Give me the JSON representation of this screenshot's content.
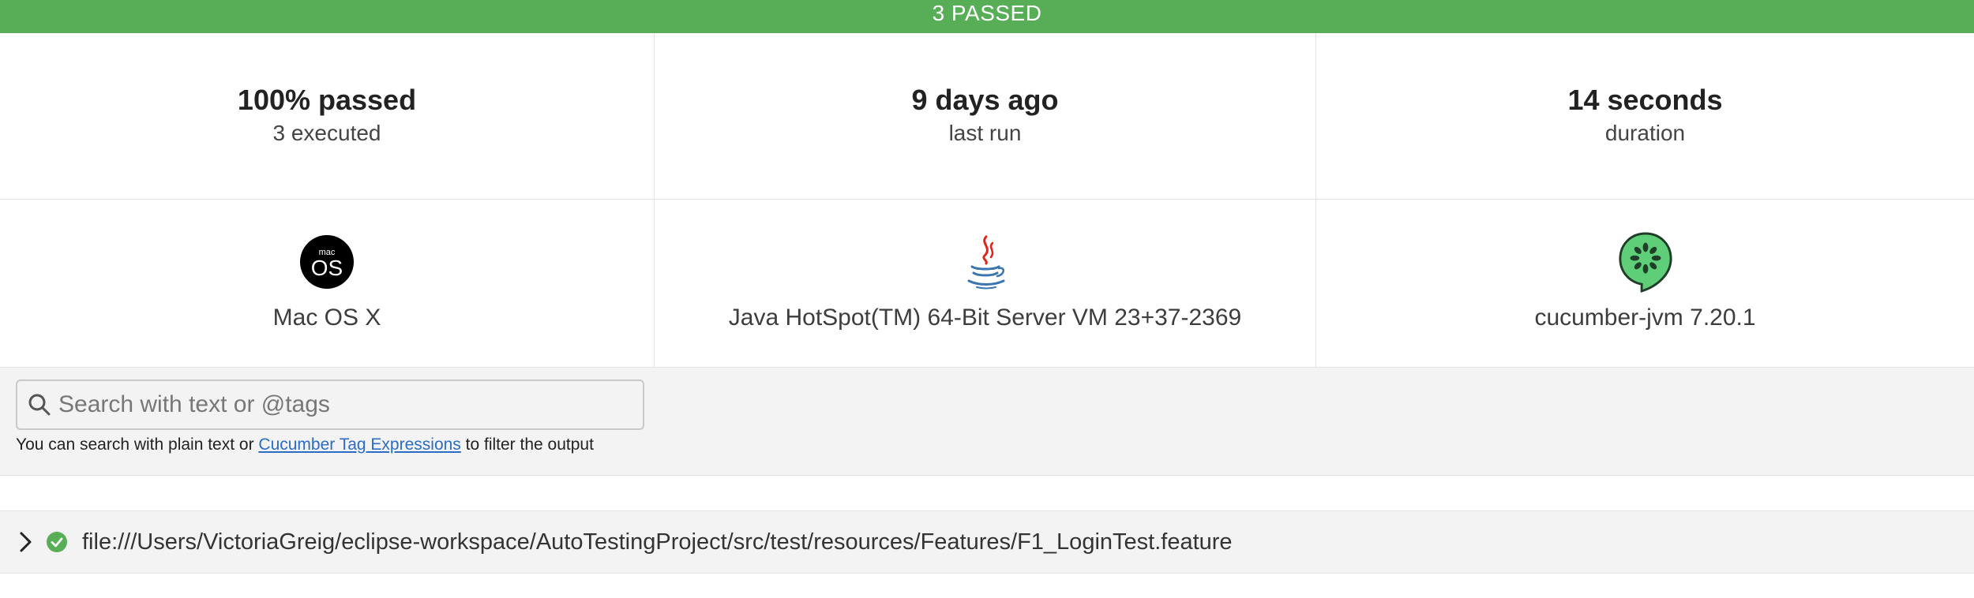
{
  "banner": {
    "status_text": "3 PASSED",
    "color": "#58ae57"
  },
  "summary": {
    "passed": {
      "value": "100% passed",
      "label": "3 executed"
    },
    "last_run": {
      "value": "9 days ago",
      "label": "last run"
    },
    "duration": {
      "value": "14 seconds",
      "label": "duration"
    }
  },
  "environment": {
    "os": {
      "icon": "macos-icon",
      "icon_text_top": "mac",
      "icon_text_main": "OS",
      "label": "Mac OS X"
    },
    "runtime": {
      "icon": "java-icon",
      "label": "Java HotSpot(TM) 64-Bit Server VM 23+37-2369"
    },
    "implementation": {
      "icon": "cucumber-icon",
      "label": "cucumber-jvm 7.20.1"
    }
  },
  "search": {
    "placeholder": "Search with text or @tags",
    "value": "",
    "help_prefix": "You can search with plain text or ",
    "help_link": "Cucumber Tag Expressions",
    "help_suffix": " to filter the output"
  },
  "features": [
    {
      "path": "file:///Users/VictoriaGreig/eclipse-workspace/AutoTestingProject/src/test/resources/Features/F1_LoginTest.feature",
      "status": "passed",
      "expanded": false
    }
  ],
  "colors": {
    "pass": "#58ae57",
    "link": "#2b6cc4",
    "cucumber": "#5fce79"
  }
}
